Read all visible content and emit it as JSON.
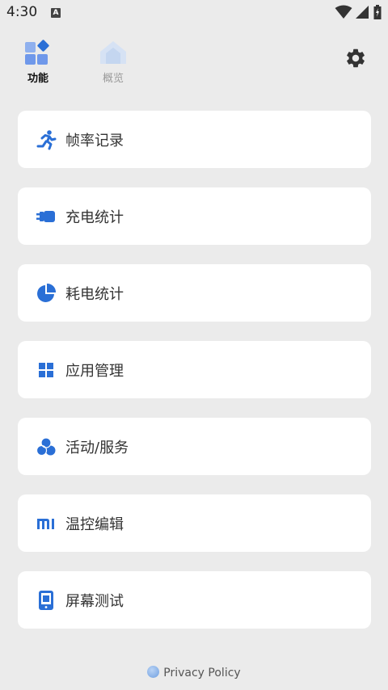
{
  "status_bar": {
    "time": "4:30",
    "notification_letter": "A"
  },
  "tabs": [
    {
      "label": "功能",
      "icon": "grid-diamond-icon",
      "active": true
    },
    {
      "label": "概览",
      "icon": "home-icon",
      "active": false
    }
  ],
  "settings_icon": "gear-icon",
  "menu": [
    {
      "label": "帧率记录",
      "icon": "running-person-icon"
    },
    {
      "label": "充电统计",
      "icon": "charger-plug-icon"
    },
    {
      "label": "耗电统计",
      "icon": "pie-chart-icon"
    },
    {
      "label": "应用管理",
      "icon": "app-grid-icon"
    },
    {
      "label": "活动/服务",
      "icon": "three-circles-icon"
    },
    {
      "label": "温控编辑",
      "icon": "mi-logo-icon"
    },
    {
      "label": "屏幕测试",
      "icon": "phone-screen-icon"
    }
  ],
  "footer": {
    "privacy_label": "Privacy Policy"
  },
  "colors": {
    "accent": "#2a6fd6",
    "background": "#ebebeb",
    "card": "#ffffff"
  }
}
